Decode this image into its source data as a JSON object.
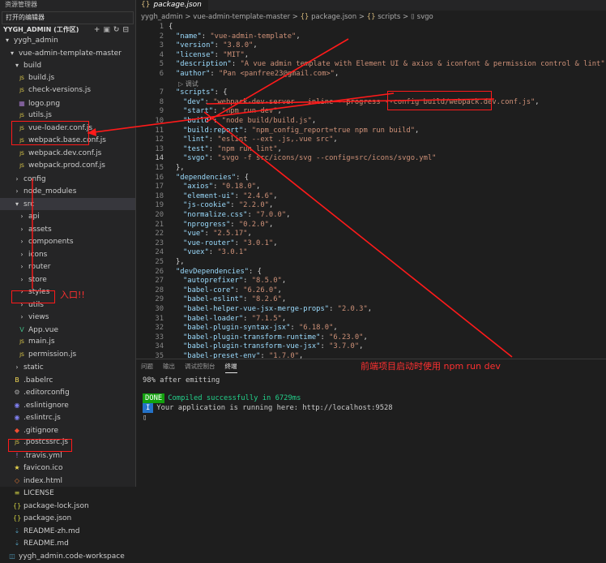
{
  "sidebar": {
    "title": "资源管理器",
    "open_editors": "打开的编辑器",
    "workspace": "YYGH_ADMIN (工作区)",
    "items": [
      {
        "label": "yygh_admin",
        "icon": "chevron-down-icon"
      },
      {
        "label": "vue-admin-template-master",
        "icon": "chevron-down-icon"
      },
      {
        "label": "build",
        "icon": "chevron-down-icon"
      },
      {
        "label": "build.js",
        "icon": "js-file-icon"
      },
      {
        "label": "check-versions.js",
        "icon": "js-file-icon"
      },
      {
        "label": "logo.png",
        "icon": "image-file-icon"
      },
      {
        "label": "utils.js",
        "icon": "js-file-icon"
      },
      {
        "label": "vue-loader.conf.js",
        "icon": "js-file-icon"
      },
      {
        "label": "webpack.base.conf.js",
        "icon": "js-file-icon"
      },
      {
        "label": "webpack.dev.conf.js",
        "icon": "js-file-icon"
      },
      {
        "label": "webpack.prod.conf.js",
        "icon": "js-file-icon"
      },
      {
        "label": "config",
        "icon": "chevron-right-icon"
      },
      {
        "label": "node_modules",
        "icon": "chevron-right-icon"
      },
      {
        "label": "src",
        "icon": "chevron-down-icon"
      },
      {
        "label": "api",
        "icon": "chevron-right-icon"
      },
      {
        "label": "assets",
        "icon": "chevron-right-icon"
      },
      {
        "label": "components",
        "icon": "chevron-right-icon"
      },
      {
        "label": "icons",
        "icon": "chevron-right-icon"
      },
      {
        "label": "router",
        "icon": "chevron-right-icon"
      },
      {
        "label": "store",
        "icon": "chevron-right-icon"
      },
      {
        "label": "styles",
        "icon": "chevron-right-icon"
      },
      {
        "label": "utils",
        "icon": "chevron-right-icon"
      },
      {
        "label": "views",
        "icon": "chevron-right-icon"
      },
      {
        "label": "App.vue",
        "icon": "vue-file-icon"
      },
      {
        "label": "main.js",
        "icon": "js-file-icon"
      },
      {
        "label": "permission.js",
        "icon": "js-file-icon"
      },
      {
        "label": "static",
        "icon": "chevron-right-icon"
      },
      {
        "label": ".babelrc",
        "icon": "babel-file-icon"
      },
      {
        "label": ".editorconfig",
        "icon": "gear-file-icon"
      },
      {
        "label": ".eslintignore",
        "icon": "eslint-file-icon"
      },
      {
        "label": ".eslintrc.js",
        "icon": "eslint-file-icon"
      },
      {
        "label": ".gitignore",
        "icon": "git-file-icon"
      },
      {
        "label": ".postcssrc.js",
        "icon": "js-file-icon"
      },
      {
        "label": ".travis.yml",
        "icon": "yaml-file-icon"
      },
      {
        "label": "favicon.ico",
        "icon": "star-file-icon"
      },
      {
        "label": "index.html",
        "icon": "html-file-icon"
      },
      {
        "label": "LICENSE",
        "icon": "license-file-icon"
      },
      {
        "label": "package-lock.json",
        "icon": "json-file-icon"
      },
      {
        "label": "package.json",
        "icon": "json-file-icon"
      },
      {
        "label": "README-zh.md",
        "icon": "markdown-file-icon"
      },
      {
        "label": "README.md",
        "icon": "markdown-file-icon"
      },
      {
        "label": "yygh_admin.code-workspace",
        "icon": "workspace-file-icon"
      }
    ]
  },
  "editor": {
    "tab_label": "package.json",
    "breadcrumb": {
      "root": "yygh_admin",
      "folder": "vue-admin-template-master",
      "file": "package.json",
      "section": "scripts",
      "key": "svgo"
    },
    "lens_text": "▷ 调试",
    "lines": [
      {
        "n": "1",
        "text": "{"
      },
      {
        "n": "2",
        "key": "\"name\"",
        "val": "\"vue-admin-template\"",
        "end": ","
      },
      {
        "n": "3",
        "key": "\"version\"",
        "val": "\"3.8.0\"",
        "end": ","
      },
      {
        "n": "4",
        "key": "\"license\"",
        "val": "\"MIT\"",
        "end": ","
      },
      {
        "n": "5",
        "key": "\"description\"",
        "val": "\"A vue admin template with Element UI & axios & iconfont & permission control & lint\"",
        "end": ","
      },
      {
        "n": "6",
        "key": "\"author\"",
        "val": "\"Pan <panfree23@gmail.com>\"",
        "end": ","
      },
      {
        "n": "7",
        "key": "\"scripts\"",
        "val": "",
        "end": "{"
      },
      {
        "n": "8",
        "key": "\"dev\"",
        "val": "\"webpack-dev-server --inline --progress --config build/webpack.dev.conf.js\"",
        "end": ","
      },
      {
        "n": "9",
        "key": "\"start\"",
        "val": "\"npm run dev\"",
        "end": ","
      },
      {
        "n": "10",
        "key": "\"build\"",
        "val": "\"node build/build.js\"",
        "end": ","
      },
      {
        "n": "11",
        "key": "\"build:report\"",
        "val": "\"npm_config_report=true npm run build\"",
        "end": ","
      },
      {
        "n": "12",
        "key": "\"lint\"",
        "val": "\"eslint --ext .js,.vue src\"",
        "end": ","
      },
      {
        "n": "13",
        "key": "\"test\"",
        "val": "\"npm run lint\"",
        "end": ","
      },
      {
        "n": "14",
        "key": "\"svgo\"",
        "val": "\"svgo -f src/icons/svg --config=src/icons/svgo.yml\"",
        "end": ""
      },
      {
        "n": "15",
        "text": "},"
      },
      {
        "n": "16",
        "key": "\"dependencies\"",
        "val": "",
        "end": "{"
      },
      {
        "n": "17",
        "key": "\"axios\"",
        "val": "\"0.18.0\"",
        "end": ","
      },
      {
        "n": "18",
        "key": "\"element-ui\"",
        "val": "\"2.4.6\"",
        "end": ","
      },
      {
        "n": "19",
        "key": "\"js-cookie\"",
        "val": "\"2.2.0\"",
        "end": ","
      },
      {
        "n": "20",
        "key": "\"normalize.css\"",
        "val": "\"7.0.0\"",
        "end": ","
      },
      {
        "n": "21",
        "key": "\"nprogress\"",
        "val": "\"0.2.0\"",
        "end": ","
      },
      {
        "n": "22",
        "key": "\"vue\"",
        "val": "\"2.5.17\"",
        "end": ","
      },
      {
        "n": "23",
        "key": "\"vue-router\"",
        "val": "\"3.0.1\"",
        "end": ","
      },
      {
        "n": "24",
        "key": "\"vuex\"",
        "val": "\"3.0.1\"",
        "end": ""
      },
      {
        "n": "25",
        "text": "},"
      },
      {
        "n": "26",
        "key": "\"devDependencies\"",
        "val": "",
        "end": "{"
      },
      {
        "n": "27",
        "key": "\"autoprefixer\"",
        "val": "\"8.5.0\"",
        "end": ","
      },
      {
        "n": "28",
        "key": "\"babel-core\"",
        "val": "\"6.26.0\"",
        "end": ","
      },
      {
        "n": "29",
        "key": "\"babel-eslint\"",
        "val": "\"8.2.6\"",
        "end": ","
      },
      {
        "n": "30",
        "key": "\"babel-helper-vue-jsx-merge-props\"",
        "val": "\"2.0.3\"",
        "end": ","
      },
      {
        "n": "31",
        "key": "\"babel-loader\"",
        "val": "\"7.1.5\"",
        "end": ","
      },
      {
        "n": "32",
        "key": "\"babel-plugin-syntax-jsx\"",
        "val": "\"6.18.0\"",
        "end": ","
      },
      {
        "n": "33",
        "key": "\"babel-plugin-transform-runtime\"",
        "val": "\"6.23.0\"",
        "end": ","
      },
      {
        "n": "34",
        "key": "\"babel-plugin-transform-vue-jsx\"",
        "val": "\"3.7.0\"",
        "end": ","
      },
      {
        "n": "35",
        "key": "\"babel-preset-env\"",
        "val": "\"1.7.0\"",
        "end": ","
      }
    ]
  },
  "panel": {
    "tabs": [
      "问题",
      "输出",
      "调试控制台",
      "终端"
    ],
    "active_tab": "终端",
    "line1": "98% after emitting",
    "done_badge": "DONE",
    "done_text": "Compiled successfully in 6729ms",
    "info_badge": "I",
    "info_text": "Your application is running here: http://localhost:9528"
  },
  "annotations": {
    "entry_note": "入口!!",
    "npm_note": "前端项目启动时使用 npm run dev",
    "color": "#ff2020"
  }
}
